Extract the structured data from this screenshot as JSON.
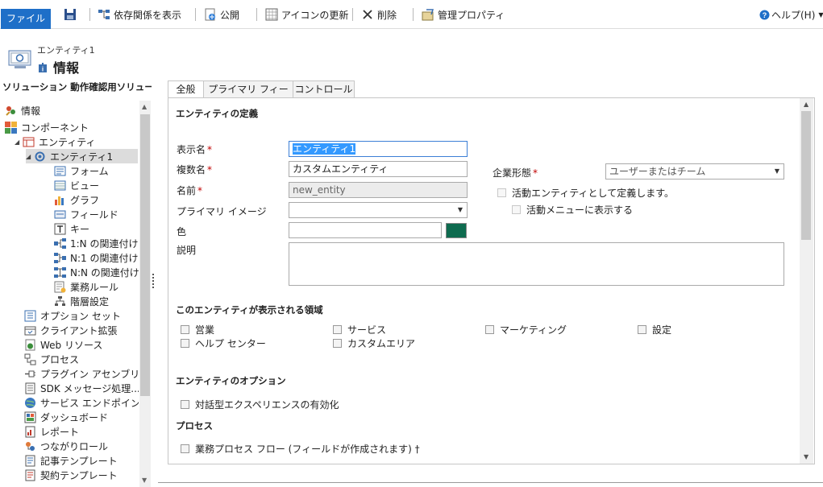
{
  "ribbon": {
    "file": "ファイル",
    "show_dependencies": "依存関係を表示",
    "publish": "公開",
    "update_icons": "アイコンの更新",
    "delete": "削除",
    "managed_properties": "管理プロパティ",
    "help": "ヘルプ(H)"
  },
  "header": {
    "entity_name": "エンティティ1",
    "page_title": "情報"
  },
  "nav": {
    "solution_title": "ソリューション 動作確認用ソリュー...",
    "items": [
      {
        "label": "情報"
      },
      {
        "label": "コンポーネント"
      },
      {
        "label": "エンティティ"
      },
      {
        "label": "エンティティ1"
      },
      {
        "label": "フォーム"
      },
      {
        "label": "ビュー"
      },
      {
        "label": "グラフ"
      },
      {
        "label": "フィールド"
      },
      {
        "label": "キー"
      },
      {
        "label": "1:N の関連付け"
      },
      {
        "label": "N:1 の関連付け"
      },
      {
        "label": "N:N の関連付け"
      },
      {
        "label": "業務ルール"
      },
      {
        "label": "階層設定"
      },
      {
        "label": "オプション セット"
      },
      {
        "label": "クライアント拡張"
      },
      {
        "label": "Web リソース"
      },
      {
        "label": "プロセス"
      },
      {
        "label": "プラグイン アセンブリ"
      },
      {
        "label": "SDK メッセージ処理..."
      },
      {
        "label": "サービス エンドポイント"
      },
      {
        "label": "ダッシュボード"
      },
      {
        "label": "レポート"
      },
      {
        "label": "つながりロール"
      },
      {
        "label": "記事テンプレート"
      },
      {
        "label": "契約テンプレート"
      }
    ]
  },
  "tabs": [
    "全般",
    "プライマリ フィールド",
    "コントロール"
  ],
  "form": {
    "section_definition": "エンティティの定義",
    "display_name_label": "表示名",
    "display_name_value": "エンティティ1",
    "plural_name_label": "複数名",
    "plural_name_value": "カスタムエンティティ",
    "name_label": "名前",
    "name_value": "new_entity",
    "primary_image_label": "プライマリ イメージ",
    "primary_image_value": "",
    "color_label": "色",
    "color_value": "",
    "description_label": "説明",
    "ownership_label": "企業形態",
    "ownership_value": "ユーザーまたはチーム",
    "activity_entity": "活動エンティティとして定義します。",
    "show_activity_menu": "活動メニューに表示する",
    "required_mark": "*",
    "section_areas": "このエンティティが表示される領域",
    "areas": [
      "営業",
      "サービス",
      "マーケティング",
      "設定",
      "ヘルプ センター",
      "カスタムエリア"
    ],
    "section_options": "エンティティのオプション",
    "interactive_experience": "対話型エクスペリエンスの有効化",
    "section_process": "プロセス",
    "business_process_flow": "業務プロセス フロー (フィールドが作成されます) †",
    "swatch_color": "#0e6b4f"
  }
}
